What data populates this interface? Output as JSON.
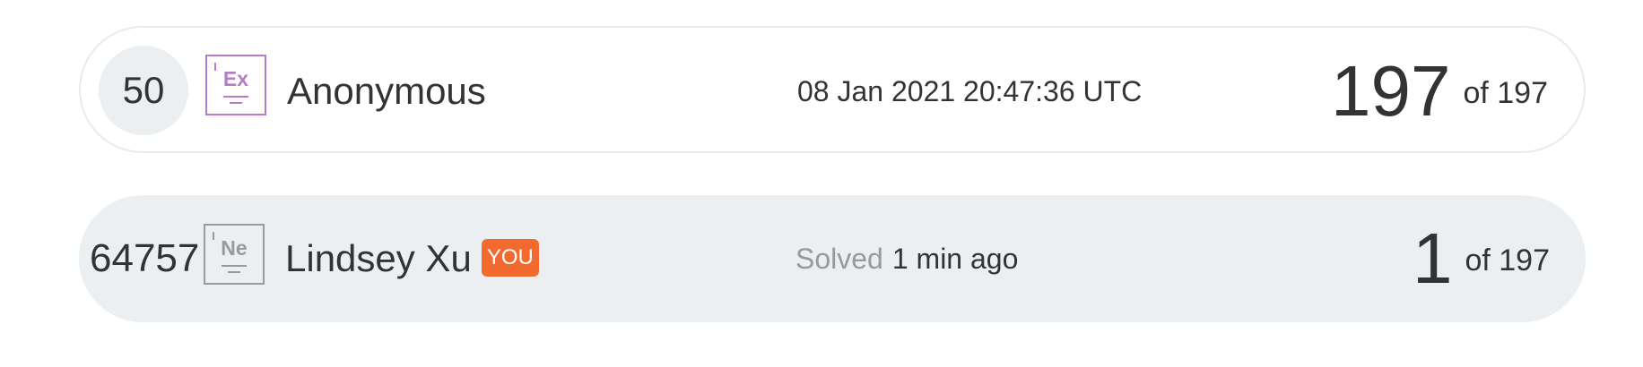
{
  "entries": [
    {
      "rank": "50",
      "element_symbol": "Ex",
      "name": "Anonymous",
      "detail": "08 Jan 2021 20:47:36 UTC",
      "solved_label": "",
      "position": "197",
      "of_label": "of 197",
      "badge_color": "#b57cc9"
    },
    {
      "rank": "64757",
      "element_symbol": "Ne",
      "name": "Lindsey Xu",
      "you_label": "YOU",
      "solved_label": "Solved",
      "detail": "1 min ago",
      "position": "1",
      "of_label": "of 197",
      "badge_color": "#9a9a9a",
      "you_color": "#f26a2e"
    }
  ]
}
